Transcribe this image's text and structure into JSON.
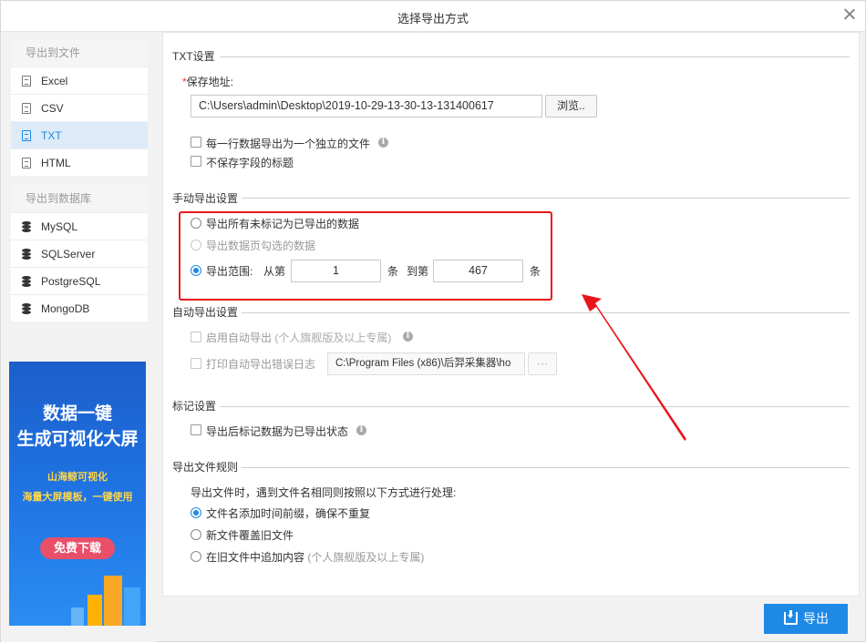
{
  "dialog": {
    "title": "选择导出方式"
  },
  "sidebar": {
    "file_group": "导出到文件",
    "file_items": [
      "Excel",
      "CSV",
      "TXT",
      "HTML"
    ],
    "db_group": "导出到数据库",
    "db_items": [
      "MySQL",
      "SQLServer",
      "PostgreSQL",
      "MongoDB"
    ],
    "active_item": "TXT"
  },
  "ad": {
    "line1": "数据一键",
    "line2": "生成可视化大屏",
    "brand": "山海鲸可视化",
    "slogan": "海量大屏模板，一键使用",
    "button": "免费下载"
  },
  "txt_settings": {
    "section": "TXT设置",
    "save_label": "保存地址:",
    "save_path": "C:\\Users\\admin\\Desktop\\2019-10-29-13-30-13-131400617",
    "browse": "浏览..",
    "opt_one_file_per_row": "每一行数据导出为一个独立的文件",
    "opt_no_field_title": "不保存字段的标题"
  },
  "manual": {
    "section": "手动导出设置",
    "opt_unmarked": "导出所有未标记为已导出的数据",
    "opt_selected": "导出数据页勾选的数据",
    "opt_range": "导出范围:",
    "from_label": "从第",
    "from_value": "1",
    "unit1": "条",
    "to_label": "到第",
    "to_value": "467",
    "unit2": "条"
  },
  "auto": {
    "section": "自动导出设置",
    "opt_enable": "启用自动导出",
    "opt_enable_note": "(个人旗舰版及以上专属)",
    "opt_log": "打印自动导出错误日志",
    "log_path": "C:\\Program Files (x86)\\后羿采集器\\ho",
    "log_browse": "···"
  },
  "mark": {
    "section": "标记设置",
    "opt_mark": "导出后标记数据为已导出状态"
  },
  "rules": {
    "section": "导出文件规则",
    "desc": "导出文件时，遇到文件名相同则按照以下方式进行处理:",
    "opt_timestamp": "文件名添加时间前缀，确保不重复",
    "opt_overwrite": "新文件覆盖旧文件",
    "opt_append": "在旧文件中追加内容",
    "opt_append_note": "(个人旗舰版及以上专属)"
  },
  "footer": {
    "export_label": "导出"
  },
  "colors": {
    "accent": "#1e88e5",
    "highlight_box": "#e8161c",
    "ad_bg": "#1f74e4"
  },
  "icons": {
    "file": "file-icon",
    "database": "database-icon",
    "info": "info-icon",
    "export": "download-icon",
    "close": "close-icon"
  }
}
